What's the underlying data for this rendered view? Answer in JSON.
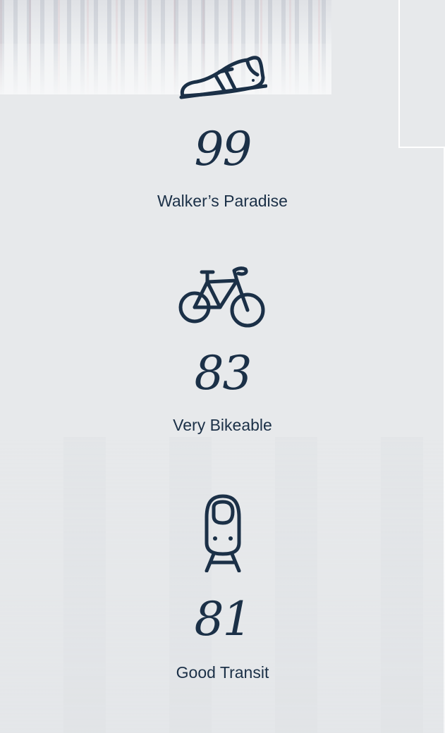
{
  "scores": {
    "walk": {
      "value": "99",
      "label": "Walker’s Paradise",
      "icon": "shoe-icon"
    },
    "bike": {
      "value": "83",
      "label": "Very Bikeable",
      "icon": "bicycle-icon"
    },
    "transit": {
      "value": "81",
      "label": "Good Transit",
      "icon": "train-icon"
    }
  },
  "colors": {
    "text": "#1b3047",
    "background": "#e7e9eb"
  }
}
